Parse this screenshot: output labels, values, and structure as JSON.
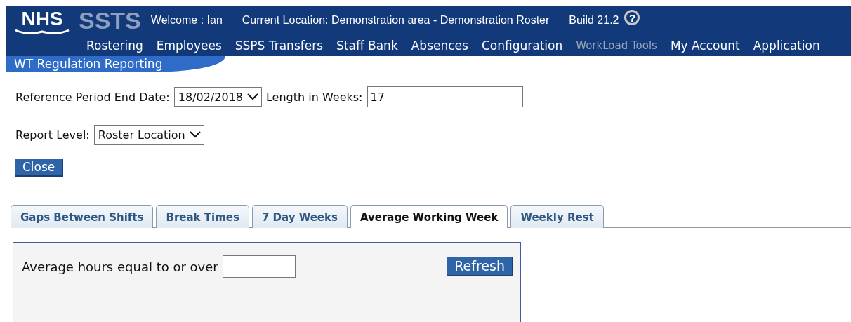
{
  "header": {
    "logo": "NHS",
    "product": "SSTS",
    "welcome": "Welcome : Ian",
    "location": "Current Location: Demonstration area - Demonstration Roster",
    "build": "Build 21.2",
    "help": "?"
  },
  "menu": [
    {
      "label": "Rostering",
      "disabled": false
    },
    {
      "label": "Employees",
      "disabled": false
    },
    {
      "label": "SSPS Transfers",
      "disabled": false
    },
    {
      "label": "Staff Bank",
      "disabled": false
    },
    {
      "label": "Absences",
      "disabled": false
    },
    {
      "label": "Configuration",
      "disabled": false
    },
    {
      "label": "WorkLoad Tools",
      "disabled": true
    },
    {
      "label": "My Account",
      "disabled": false
    },
    {
      "label": "Application",
      "disabled": false
    }
  ],
  "page_title": "WT Regulation Reporting",
  "form": {
    "end_date_label": "Reference Period End Date:",
    "end_date": "18/02/2018",
    "length_label": "Length in Weeks:",
    "length": "17",
    "report_level_label": "Report Level:",
    "report_level": "Roster Location",
    "close": "Close"
  },
  "tabs": [
    {
      "label": "Gaps Between Shifts",
      "selected": false
    },
    {
      "label": "Break Times",
      "selected": false
    },
    {
      "label": "7 Day Weeks",
      "selected": false
    },
    {
      "label": "Average Working Week",
      "selected": true
    },
    {
      "label": "Weekly Rest",
      "selected": false
    }
  ],
  "panel": {
    "hours_label": "Average hours equal to or over",
    "refresh": "Refresh"
  }
}
